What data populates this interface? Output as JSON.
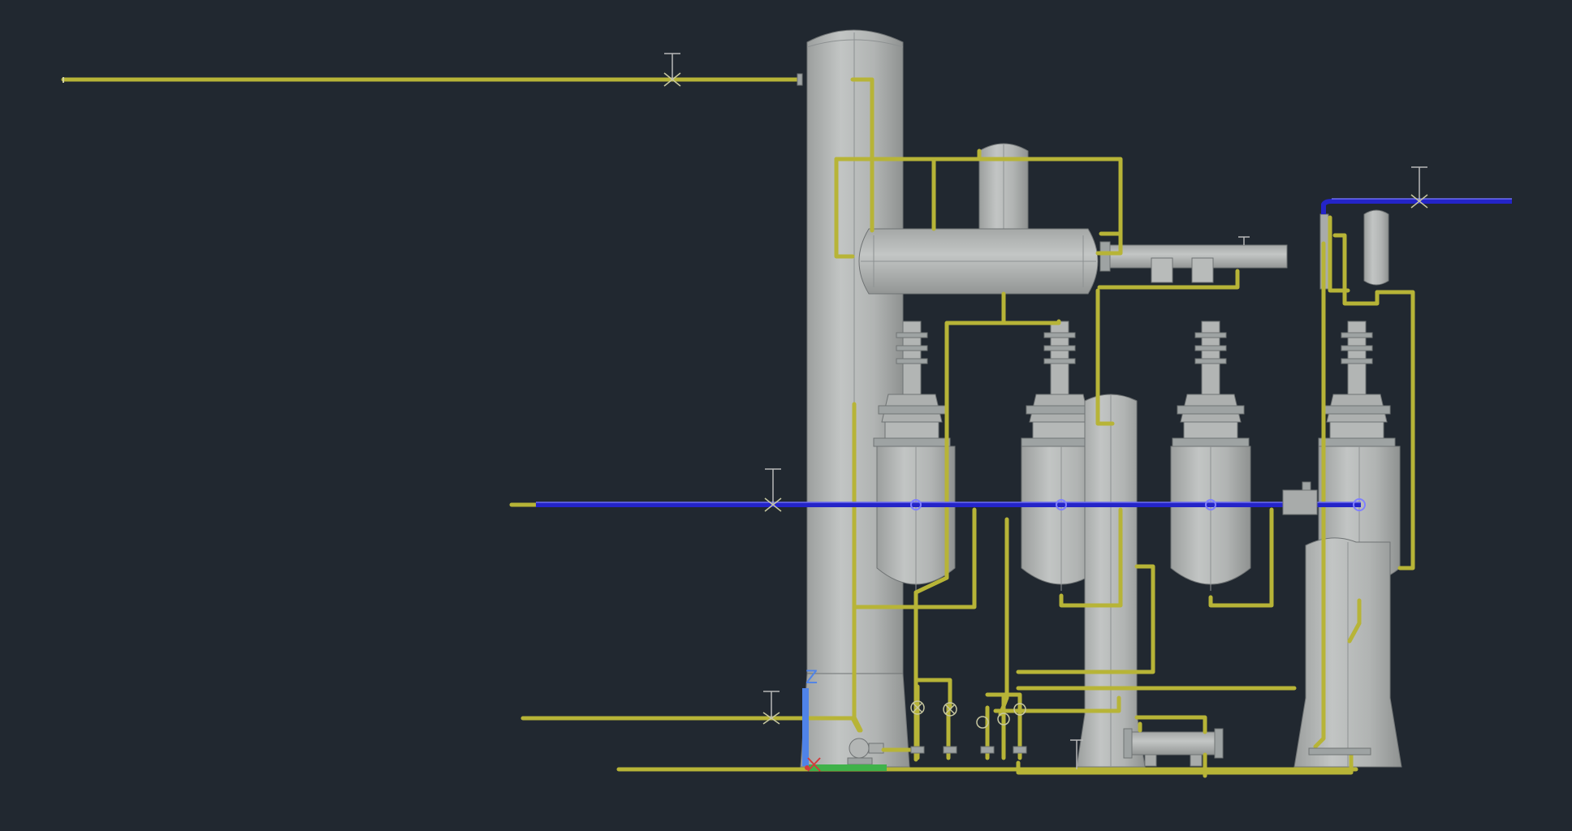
{
  "ucs_icon": {
    "z_label": "Z",
    "axis_colors": {
      "z": "#4f83e8",
      "x": "#d23c3c",
      "y": "#3fb24a"
    }
  },
  "colors": {
    "background": "#212830",
    "equipment": "#b3b6b5",
    "process_pipe": "#b7b437",
    "utility_pipe": "#2424c8"
  },
  "equipment": [
    {
      "name": "distillation-column",
      "icon": "tall-column"
    },
    {
      "name": "horizontal-drum",
      "icon": "horizontal-vessel"
    },
    {
      "name": "vertical-drum-top",
      "icon": "vertical-vessel"
    },
    {
      "name": "condenser",
      "icon": "heat-exchanger"
    },
    {
      "name": "reactor-1",
      "icon": "reactor"
    },
    {
      "name": "reactor-2",
      "icon": "reactor"
    },
    {
      "name": "reactor-3",
      "icon": "reactor"
    },
    {
      "name": "reactor-4",
      "icon": "reactor"
    },
    {
      "name": "small-column",
      "icon": "column"
    },
    {
      "name": "right-column",
      "icon": "column"
    },
    {
      "name": "small-separator",
      "icon": "vertical-vessel"
    },
    {
      "name": "bottom-exchanger",
      "icon": "heat-exchanger"
    },
    {
      "name": "pump",
      "icon": "pump"
    }
  ]
}
